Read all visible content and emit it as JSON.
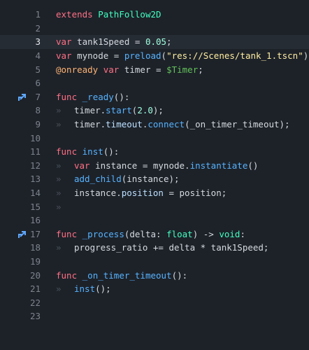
{
  "editor": {
    "lines": [
      {
        "n": "1",
        "tokens": [
          [
            "kw",
            "extends"
          ],
          [
            "txt",
            " "
          ],
          [
            "type",
            "PathFollow2D"
          ]
        ]
      },
      {
        "n": "2",
        "tokens": []
      },
      {
        "n": "3",
        "current": true,
        "tokens": [
          [
            "kw",
            "var"
          ],
          [
            "txt",
            " tank1Speed = "
          ],
          [
            "num",
            "0.05"
          ],
          [
            "txt",
            ";"
          ]
        ]
      },
      {
        "n": "4",
        "tokens": [
          [
            "kw",
            "var"
          ],
          [
            "txt",
            " mynode = "
          ],
          [
            "fn",
            "preload"
          ],
          [
            "txt",
            "("
          ],
          [
            "str",
            "\"res://Scenes/tank_1.tscn\""
          ],
          [
            "txt",
            ");"
          ]
        ]
      },
      {
        "n": "5",
        "tokens": [
          [
            "ann",
            "@onready"
          ],
          [
            "txt",
            " "
          ],
          [
            "kw",
            "var"
          ],
          [
            "txt",
            " timer = "
          ],
          [
            "node",
            "$Timer"
          ],
          [
            "txt",
            ";"
          ]
        ]
      },
      {
        "n": "6",
        "tokens": []
      },
      {
        "n": "7",
        "override": true,
        "tokens": [
          [
            "kw",
            "func"
          ],
          [
            "txt",
            " "
          ],
          [
            "fn",
            "_ready"
          ],
          [
            "txt",
            "():"
          ]
        ]
      },
      {
        "n": "8",
        "indent": 1,
        "tokens": [
          [
            "txt",
            "timer."
          ],
          [
            "fn",
            "start"
          ],
          [
            "txt",
            "("
          ],
          [
            "num",
            "2.0"
          ],
          [
            "txt",
            ");"
          ]
        ]
      },
      {
        "n": "9",
        "indent": 1,
        "tokens": [
          [
            "txt",
            "timer."
          ],
          [
            "member",
            "timeout"
          ],
          [
            "txt",
            "."
          ],
          [
            "fn",
            "connect"
          ],
          [
            "txt",
            "(_on_timer_timeout);"
          ]
        ]
      },
      {
        "n": "10",
        "tokens": []
      },
      {
        "n": "11",
        "tokens": [
          [
            "kw",
            "func"
          ],
          [
            "txt",
            " "
          ],
          [
            "fn",
            "inst"
          ],
          [
            "txt",
            "():"
          ]
        ]
      },
      {
        "n": "12",
        "indent": 1,
        "tokens": [
          [
            "kw",
            "var"
          ],
          [
            "txt",
            " instance = mynode."
          ],
          [
            "fn",
            "instantiate"
          ],
          [
            "txt",
            "()"
          ]
        ]
      },
      {
        "n": "13",
        "indent": 1,
        "tokens": [
          [
            "fn",
            "add_child"
          ],
          [
            "txt",
            "(instance);"
          ]
        ]
      },
      {
        "n": "14",
        "indent": 1,
        "tokens": [
          [
            "txt",
            "instance."
          ],
          [
            "member",
            "position"
          ],
          [
            "txt",
            " = position;"
          ]
        ]
      },
      {
        "n": "15",
        "indent": 1,
        "tokens": []
      },
      {
        "n": "16",
        "tokens": []
      },
      {
        "n": "17",
        "override": true,
        "tokens": [
          [
            "kw",
            "func"
          ],
          [
            "txt",
            " "
          ],
          [
            "fn",
            "_process"
          ],
          [
            "txt",
            "(delta: "
          ],
          [
            "type",
            "float"
          ],
          [
            "txt",
            ") -> "
          ],
          [
            "type",
            "void"
          ],
          [
            "txt",
            ":"
          ]
        ]
      },
      {
        "n": "18",
        "indent": 1,
        "tokens": [
          [
            "txt",
            "progress_ratio += delta * tank1Speed;"
          ]
        ]
      },
      {
        "n": "19",
        "tokens": []
      },
      {
        "n": "20",
        "tokens": [
          [
            "kw",
            "func"
          ],
          [
            "txt",
            " "
          ],
          [
            "fn",
            "_on_timer_timeout"
          ],
          [
            "txt",
            "():"
          ]
        ]
      },
      {
        "n": "21",
        "indent": 1,
        "tokens": [
          [
            "fn",
            "inst"
          ],
          [
            "txt",
            "();"
          ]
        ]
      },
      {
        "n": "22",
        "tokens": []
      },
      {
        "n": "23",
        "tokens": []
      }
    ],
    "tab_glyph": "»",
    "colors": {
      "background": "#1d2229",
      "current_line": "#262c34",
      "keyword": "#ff7085",
      "function": "#57b3ff",
      "string": "#ffeda1",
      "number": "#a1ffe0",
      "type": "#42ffc2",
      "annotation": "#ffb373",
      "node_path": "#63c259",
      "override_icon": "#5fa7ff"
    },
    "override_icon_name": "method-override-icon"
  }
}
